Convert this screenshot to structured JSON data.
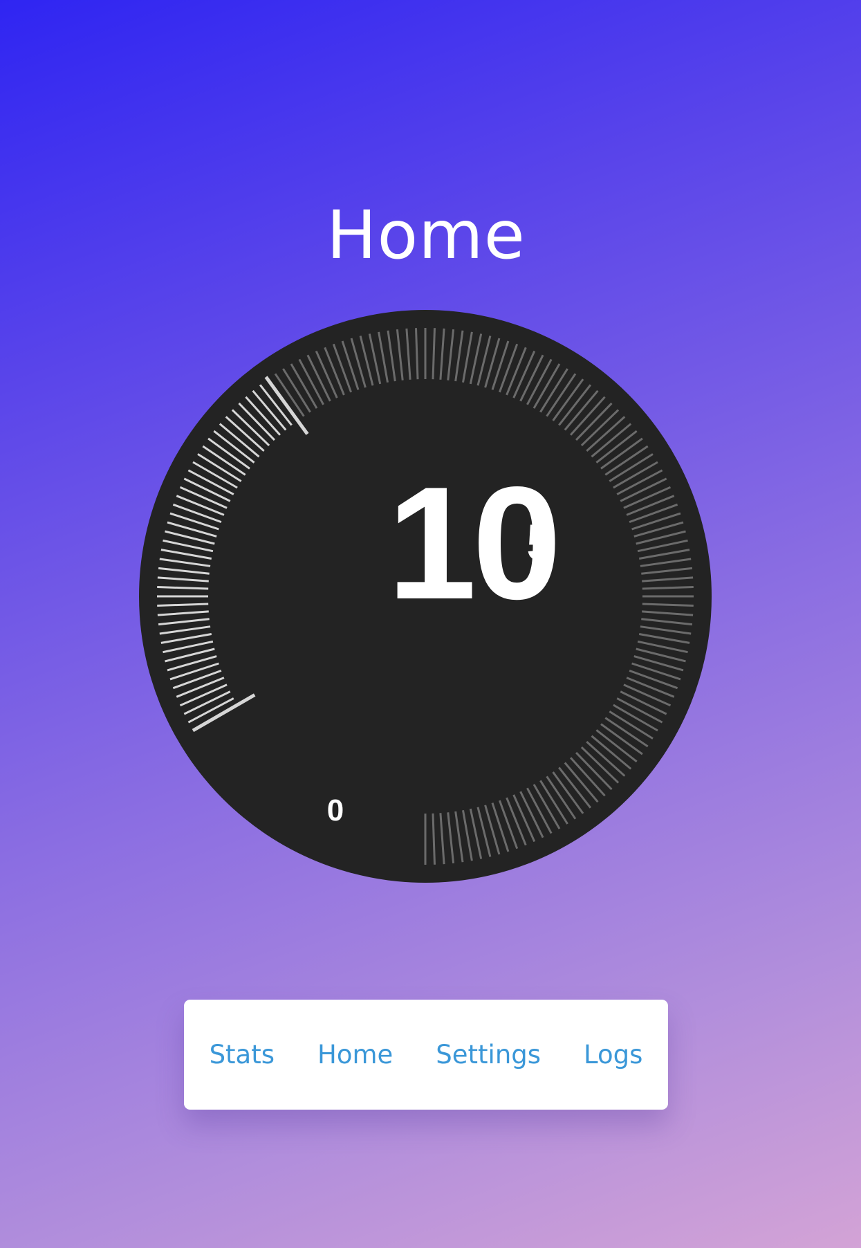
{
  "header": {
    "title": "Home"
  },
  "dial": {
    "value_main": "10",
    "value_sub": "5",
    "scale_min_label": "0",
    "fill_fraction": 0.28,
    "colors": {
      "face": "#232323",
      "tick_active": "#d6d6d6",
      "tick_inactive": "#6b6b6b",
      "text": "#ffffff"
    }
  },
  "nav": {
    "items": [
      {
        "label": "Stats"
      },
      {
        "label": "Home"
      },
      {
        "label": "Settings"
      },
      {
        "label": "Logs"
      }
    ]
  },
  "colors": {
    "background_start": "#2f25f2",
    "background_end": "#d3a3d6",
    "nav_text": "#3a97d8",
    "nav_bg": "#ffffff"
  }
}
